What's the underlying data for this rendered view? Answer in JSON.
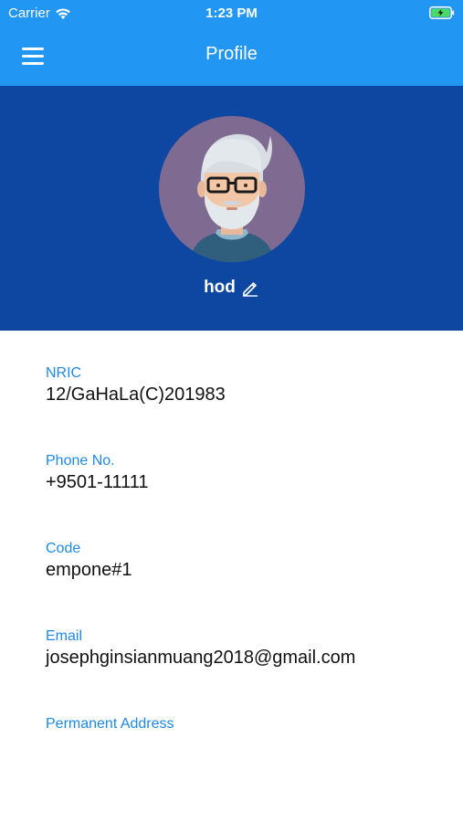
{
  "status_bar": {
    "carrier": "Carrier",
    "time": "1:23 PM"
  },
  "nav": {
    "title": "Profile"
  },
  "profile": {
    "username": "hod"
  },
  "fields": [
    {
      "label": "NRIC",
      "value": "12/GaHaLa(C)201983"
    },
    {
      "label": "Phone No.",
      "value": "+9501-11111"
    },
    {
      "label": "Code",
      "value": "empone#1"
    },
    {
      "label": "Email",
      "value": "josephginsianmuang2018@gmail.com"
    },
    {
      "label": "Permanent Address",
      "value": ""
    }
  ],
  "colors": {
    "nav_bar": "#2196f3",
    "profile_header": "#0d47a1",
    "field_label": "#1e88e5",
    "battery": "#4cd964"
  },
  "icons": {
    "menu": "hamburger-menu-icon",
    "edit": "pencil-icon",
    "wifi": "wifi-icon",
    "battery": "battery-charging-icon"
  }
}
